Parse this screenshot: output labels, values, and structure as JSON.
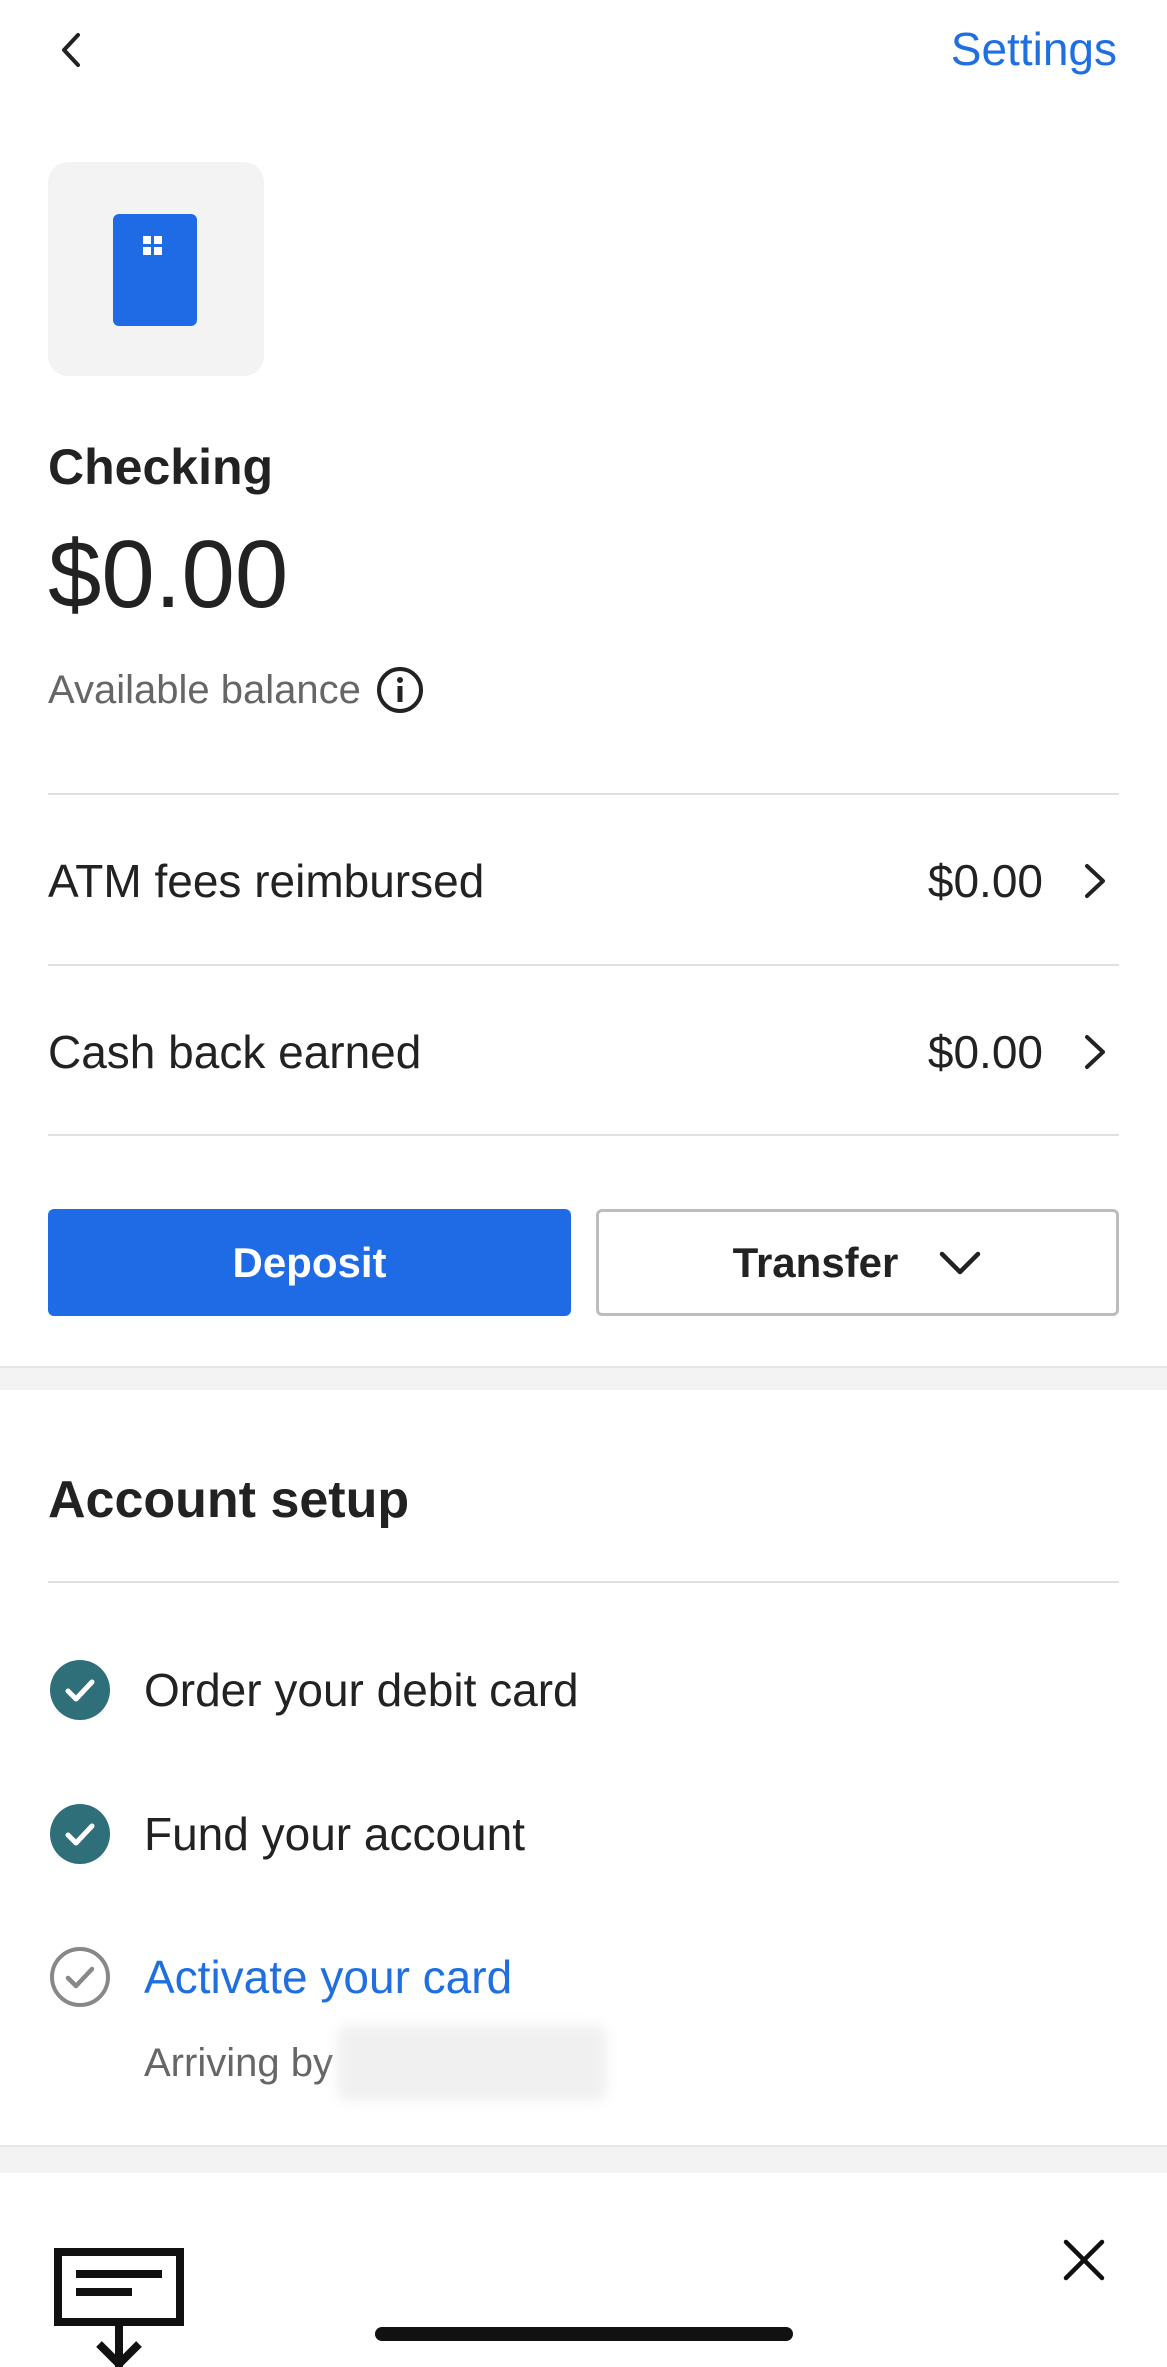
{
  "header": {
    "back_icon": "chevron-left-icon",
    "settings_label": "Settings"
  },
  "account": {
    "icon": "debit-card-icon",
    "name": "Checking",
    "balance": "$0.00",
    "available_label": "Available balance",
    "info_icon": "info-circle-icon"
  },
  "summary_rows": [
    {
      "label": "ATM fees reimbursed",
      "value": "$0.00"
    },
    {
      "label": "Cash back earned",
      "value": "$0.00"
    }
  ],
  "actions": {
    "deposit_label": "Deposit",
    "transfer_label": "Transfer"
  },
  "setup": {
    "title": "Account setup",
    "tasks": [
      {
        "label": "Order your debit card",
        "completed": true
      },
      {
        "label": "Fund your account",
        "completed": true
      },
      {
        "label": "Activate your card",
        "completed": false
      }
    ],
    "arriving_label": "Arriving by"
  },
  "colors": {
    "accent": "#1f6be6",
    "link": "#1f6fe0",
    "check_complete": "#2f6f7a"
  }
}
